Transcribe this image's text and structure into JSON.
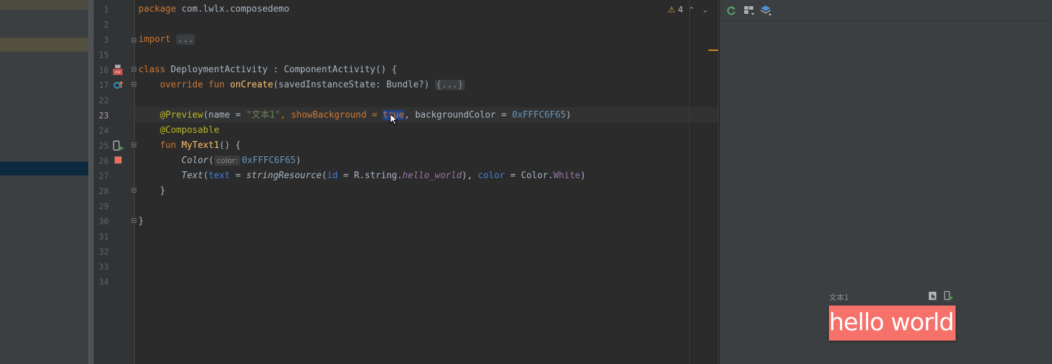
{
  "editor": {
    "line_numbers": [
      "1",
      "2",
      "3",
      "15",
      "16",
      "17",
      "22",
      "23",
      "24",
      "25",
      "26",
      "27",
      "28",
      "29",
      "30",
      "31",
      "32",
      "33",
      "34"
    ],
    "current_line": "23",
    "warnings": {
      "count": "4"
    },
    "lines": {
      "l1": {
        "kw": "package",
        "rest": " com.lwlx.composedemo"
      },
      "l3": {
        "kw": "import",
        "folded": "..."
      },
      "l16": {
        "kw": "class",
        "name": " DeploymentActivity : ComponentActivity() {"
      },
      "l17": {
        "kw1": "override",
        "kw2": "fun",
        "fn": "onCreate",
        "params": "(savedInstanceState: Bundle?)",
        "folded": "{...}"
      },
      "l23": {
        "ann": "@Preview",
        "p1": "(name = ",
        "str": "\"文本1\"",
        "p2": ", showBackground = ",
        "sel": "true",
        "p3": ", backgroundColor = ",
        "num": "0xFFFC6F65",
        "p4": ")"
      },
      "l24": {
        "ann": "@Composable"
      },
      "l25": {
        "kw": "fun",
        "fn": "MyText1",
        "rest": "() {"
      },
      "l26": {
        "call": "Color",
        "open": "(",
        "hint": "color:",
        "num": "0xFFFC6F65",
        "close": ")"
      },
      "l27": {
        "call": "Text",
        "open": "(",
        "named1": "text",
        "eq1": " = ",
        "call2": "stringResource",
        "open2": "(",
        "named2": "id",
        "eq2": " = R.string.",
        "prop1": "hello_world",
        "close2": "), ",
        "named3": "color",
        "eq3": " = Color.",
        "prop2": "White",
        "close": ")"
      },
      "l28": {
        "text": "}"
      },
      "l30": {
        "text": "}"
      }
    }
  },
  "preview": {
    "title": "文本1",
    "text": "hello world",
    "background_color": "#FFFC6F65",
    "text_color": "White",
    "toolbar_icons": [
      "refresh-icon",
      "layout-icon",
      "layers-icon"
    ]
  }
}
